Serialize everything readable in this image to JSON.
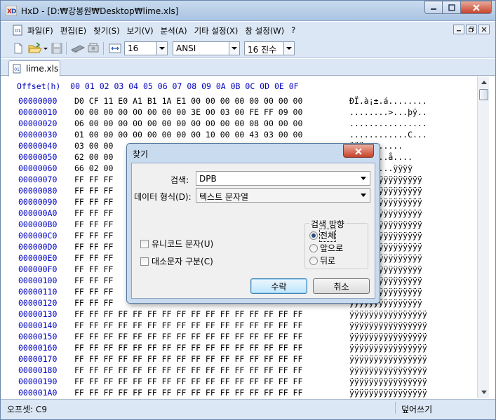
{
  "window": {
    "title": "HxD - [D:₩강봉원₩Desktop₩lime.xls]"
  },
  "menu": {
    "items": [
      "파일(F)",
      "편집(E)",
      "찾기(S)",
      "보기(V)",
      "분석(A)",
      "기타 설정(X)",
      "창 설정(W)",
      "?"
    ]
  },
  "toolbar": {
    "bytes_per_row": "16",
    "charset": "ANSI",
    "offset_base": "16 진수"
  },
  "tabs": [
    "lime.xls"
  ],
  "hex": {
    "header": "Offset(h)  00 01 02 03 04 05 06 07 08 09 0A 0B 0C 0D 0E 0F",
    "rows": [
      {
        "offset": "00000000",
        "bytes": "D0 CF 11 E0 A1 B1 1A E1 00 00 00 00 00 00 00 00",
        "ascii": "ÐÏ.à¡±.á........"
      },
      {
        "offset": "00000010",
        "bytes": "00 00 00 00 00 00 00 00 3E 00 03 00 FE FF 09 00",
        "ascii": "........>...þÿ.."
      },
      {
        "offset": "00000020",
        "bytes": "06 00 00 00 00 00 00 00 00 00 00 00 08 00 00 00",
        "ascii": "................"
      },
      {
        "offset": "00000030",
        "bytes": "01 00 00 00 00 00 00 00 00 10 00 00 43 03 00 00",
        "ascii": "............C..."
      },
      {
        "offset": "00000040",
        "bytes": "03 00 00",
        "ascii": "ÿÿÿ........"
      },
      {
        "offset": "00000050",
        "bytes": "62 00 00",
        "ascii": "....d...å...."
      },
      {
        "offset": "00000060",
        "bytes": "66 02 00",
        "ascii": "....€....ÿÿÿÿ"
      },
      {
        "offset": "00000070",
        "bytes": "FF FF FF",
        "ascii": "ÿÿÿÿÿÿÿÿÿÿÿÿÿÿÿ"
      },
      {
        "offset": "00000080",
        "bytes": "FF FF FF",
        "ascii": "ÿÿÿÿÿÿÿÿÿÿÿÿÿÿÿ"
      },
      {
        "offset": "00000090",
        "bytes": "FF FF FF",
        "ascii": "ÿÿÿÿÿÿÿÿÿÿÿÿÿÿÿ"
      },
      {
        "offset": "000000A0",
        "bytes": "FF FF FF",
        "ascii": "ÿÿÿÿÿÿÿÿÿÿÿÿÿÿÿ"
      },
      {
        "offset": "000000B0",
        "bytes": "FF FF FF",
        "ascii": "ÿÿÿÿÿÿÿÿÿÿÿÿÿÿÿ"
      },
      {
        "offset": "000000C0",
        "bytes": "FF FF FF",
        "ascii": "ÿÿÿÿÿÿÿÿÿÿÿÿÿÿÿ"
      },
      {
        "offset": "000000D0",
        "bytes": "FF FF FF",
        "ascii": "ÿÿÿÿÿÿÿÿÿÿÿÿÿÿÿ"
      },
      {
        "offset": "000000E0",
        "bytes": "FF FF FF",
        "ascii": "ÿÿÿÿÿÿÿÿÿÿÿÿÿÿÿ"
      },
      {
        "offset": "000000F0",
        "bytes": "FF FF FF",
        "ascii": "ÿÿÿÿÿÿÿÿÿÿÿÿÿÿÿ"
      },
      {
        "offset": "00000100",
        "bytes": "FF FF FF",
        "ascii": "ÿÿÿÿÿÿÿÿÿÿÿÿÿÿÿ"
      },
      {
        "offset": "00000110",
        "bytes": "FF FF FF",
        "ascii": "ÿÿÿÿÿÿÿÿÿÿÿÿÿÿÿ"
      },
      {
        "offset": "00000120",
        "bytes": "FF FF FF",
        "ascii": "ÿÿÿÿÿÿÿÿÿÿÿÿÿÿÿ"
      },
      {
        "offset": "00000130",
        "bytes": "FF FF FF FF FF FF FF FF FF FF FF FF FF FF FF FF",
        "ascii": "ÿÿÿÿÿÿÿÿÿÿÿÿÿÿÿÿ"
      },
      {
        "offset": "00000140",
        "bytes": "FF FF FF FF FF FF FF FF FF FF FF FF FF FF FF FF",
        "ascii": "ÿÿÿÿÿÿÿÿÿÿÿÿÿÿÿÿ"
      },
      {
        "offset": "00000150",
        "bytes": "FF FF FF FF FF FF FF FF FF FF FF FF FF FF FF FF",
        "ascii": "ÿÿÿÿÿÿÿÿÿÿÿÿÿÿÿÿ"
      },
      {
        "offset": "00000160",
        "bytes": "FF FF FF FF FF FF FF FF FF FF FF FF FF FF FF FF",
        "ascii": "ÿÿÿÿÿÿÿÿÿÿÿÿÿÿÿÿ"
      },
      {
        "offset": "00000170",
        "bytes": "FF FF FF FF FF FF FF FF FF FF FF FF FF FF FF FF",
        "ascii": "ÿÿÿÿÿÿÿÿÿÿÿÿÿÿÿÿ"
      },
      {
        "offset": "00000180",
        "bytes": "FF FF FF FF FF FF FF FF FF FF FF FF FF FF FF FF",
        "ascii": "ÿÿÿÿÿÿÿÿÿÿÿÿÿÿÿÿ"
      },
      {
        "offset": "00000190",
        "bytes": "FF FF FF FF FF FF FF FF FF FF FF FF FF FF FF FF",
        "ascii": "ÿÿÿÿÿÿÿÿÿÿÿÿÿÿÿÿ"
      },
      {
        "offset": "000001A0",
        "bytes": "FF FF FF FF FF FF FF FF FF FF FF FF FF FF FF FF",
        "ascii": "ÿÿÿÿÿÿÿÿÿÿÿÿÿÿÿÿ"
      }
    ]
  },
  "statusbar": {
    "offset": "오프셋: C9",
    "mode": "덮어쓰기"
  },
  "dialog": {
    "title": "찾기",
    "search_label": "검색:",
    "search_value": "DPB",
    "datatype_label": "데이터 형식(D):",
    "datatype_value": "텍스트 문자열",
    "unicode_label": "유니코드 문자(U)",
    "case_label": "대소문자 구분(C)",
    "direction_label": "검색 방향",
    "dir_all": "전체",
    "dir_forward": "앞으로",
    "dir_backward": "뒤로",
    "ok_label": "수락",
    "cancel_label": "취소"
  },
  "colors": {
    "offset_text": "#0000c0",
    "chrome": "#dce7f5",
    "close_button": "#c7432b"
  },
  "icons": [
    "app-icon",
    "new-file-icon",
    "open-folder-icon",
    "save-icon",
    "ram-icon",
    "disk-icon",
    "bytes-per-row-icon",
    "close-icon",
    "minimize-icon",
    "maximize-icon"
  ]
}
